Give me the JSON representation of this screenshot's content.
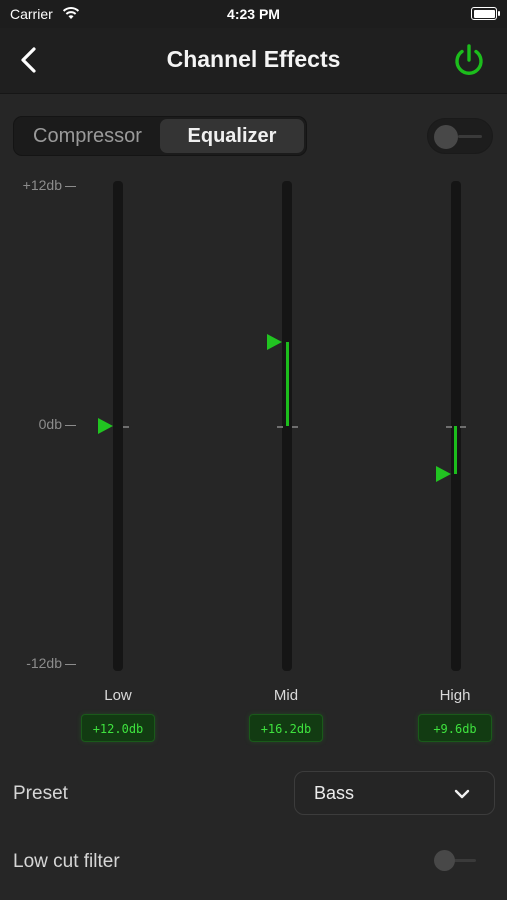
{
  "status_bar": {
    "carrier": "Carrier",
    "time": "4:23 PM",
    "icons": [
      "wifi-icon",
      "battery-icon"
    ]
  },
  "nav": {
    "title": "Channel Effects",
    "back_icon": "chevron-left-icon",
    "power_icon": "power-icon",
    "accent_color": "#1cbd1c"
  },
  "tabs": [
    {
      "label": "Compressor",
      "selected": false
    },
    {
      "label": "Equalizer",
      "selected": true
    }
  ],
  "effect_enabled": false,
  "scale": {
    "top": "+12db",
    "mid": "0db",
    "bottom": "-12db"
  },
  "bands": [
    {
      "label": "Low",
      "value_text": "+12.0db",
      "level_fraction": 0.0
    },
    {
      "label": "Mid",
      "value_text": "+16.2db",
      "level_fraction": 0.35
    },
    {
      "label": "High",
      "value_text": "+9.6db",
      "level_fraction": -0.2
    }
  ],
  "preset": {
    "label": "Preset",
    "value": "Bass",
    "chevron_icon": "chevron-down-icon"
  },
  "low_cut_filter": {
    "label": "Low cut filter",
    "enabled": false
  }
}
